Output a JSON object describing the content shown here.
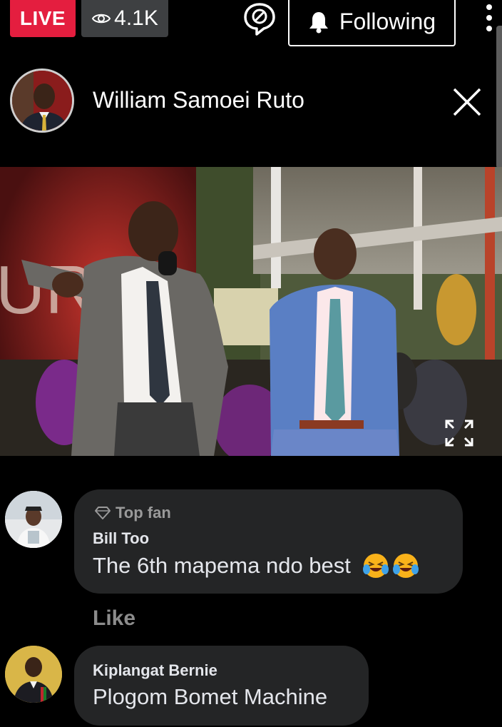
{
  "top_bar": {
    "live_label": "LIVE",
    "viewer_count": "4.1K",
    "following_label": "Following"
  },
  "host": {
    "name": "William Samoei Ruto"
  },
  "video": {
    "stage_backdrop_text": "URC"
  },
  "comments": [
    {
      "badge": "Top fan",
      "author": "Bill Too",
      "text": "The 6th mapema ndo best",
      "emoji_count": 2,
      "emoji": "face-with-tears-of-joy",
      "action_label": "Like"
    },
    {
      "author": "Kiplangat Bernie",
      "text": "Plogom Bomet Machine"
    }
  ],
  "colors": {
    "live_red": "#e41e3f",
    "viewer_badge_gray": "#3e4042",
    "bubble_bg": "#242526",
    "muted_text": "#8c8c8c"
  }
}
